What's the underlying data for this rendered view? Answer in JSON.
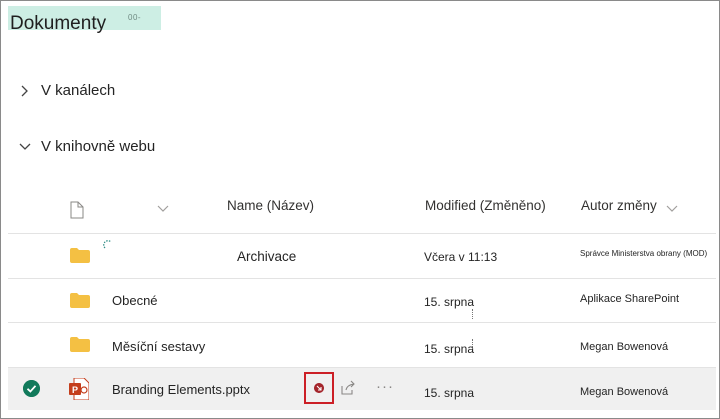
{
  "page": {
    "title": "Dokumenty",
    "title_tag": "00-"
  },
  "nav": {
    "channels_label": "V kanálech",
    "site_library_label": "V knihovně webu"
  },
  "columns": {
    "name": "Name (Název)",
    "modified": "Modified (Změněno)",
    "author": "Autor změny"
  },
  "rows": [
    {
      "type": "folder",
      "name": "Archivace",
      "modified": "Včera v 11:13",
      "author": "Správce Ministerstva obrany (MOD)"
    },
    {
      "type": "folder",
      "name": "Obecné",
      "modified": "15. srpna",
      "author": "Aplikace SharePoint"
    },
    {
      "type": "folder",
      "name": "Měsíční sestavy",
      "modified": "15. srpna",
      "author": "Megan Bowenová"
    },
    {
      "type": "pptx",
      "name": "Branding Elements.pptx",
      "modified": "15. srpna",
      "author": "Megan Bowenová",
      "selected": true
    }
  ],
  "icons": {
    "folder": "folder-icon",
    "pptx": "powerpoint-file-icon",
    "check": "checkmark-circle-icon",
    "sync": "sync-status-icon",
    "share": "share-icon",
    "more": "more-options-icon"
  },
  "colors": {
    "title_highlight": "#cdeee4",
    "folder": "#f4c043",
    "powerpoint": "#c43e1c",
    "check": "#127a5b",
    "annotation_box": "#cc1f26"
  }
}
